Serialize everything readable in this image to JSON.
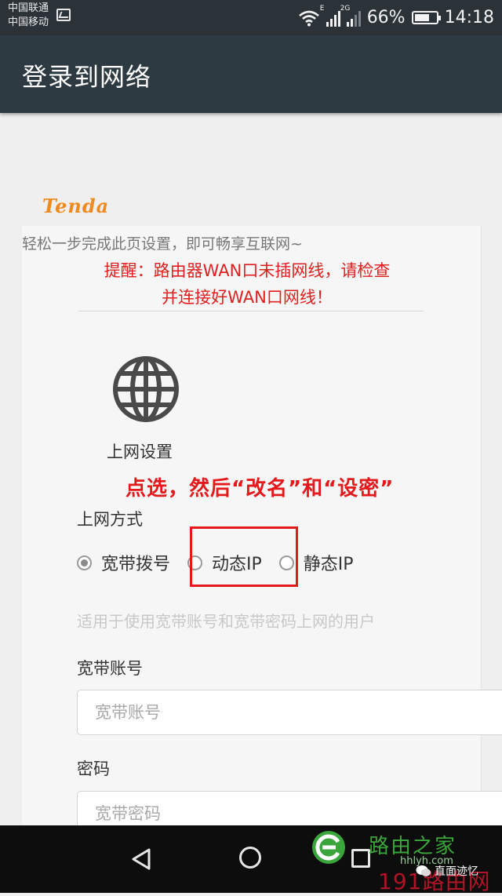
{
  "status_bar": {
    "carrier_1": "中国联通",
    "carrier_2": "中国移动",
    "network_tag_1": "E",
    "network_tag_2": "2G",
    "battery_percent": "66%",
    "time": "14:18",
    "icons": [
      "gallery-icon",
      "wifi-icon",
      "signal-icon",
      "signal-icon",
      "battery-icon"
    ]
  },
  "app_bar": {
    "title": "登录到网络"
  },
  "brand": {
    "logo_text": "Tenda",
    "logo_color": "#ef8a1e"
  },
  "page": {
    "intro": "轻松一步完成此页设置，即可畅享互联网~",
    "reminder_line_1": "提醒：路由器WAN口未插网线，请检查",
    "reminder_line_2": "并连接好WAN口网线！",
    "section_title": "上网设置",
    "section_icon": "globe-icon"
  },
  "annotation": {
    "text": "点选，然后“改名”和“设密”",
    "color": "#e3191b"
  },
  "connection": {
    "label": "上网方式",
    "options": [
      {
        "label": "宽带拨号",
        "checked": true
      },
      {
        "label": "动态IP",
        "checked": false
      },
      {
        "label": "静态IP",
        "checked": false
      }
    ],
    "hint": "适用于使用宽带账号和宽带密码上网的用户"
  },
  "account": {
    "label": "宽带账号",
    "placeholder": "宽带账号"
  },
  "password": {
    "label": "密码",
    "placeholder": "宽带密码"
  },
  "nav_bar": {
    "icons": [
      "back-icon",
      "home-icon",
      "recent-apps-icon"
    ]
  },
  "watermark": {
    "site_name": "路由之家",
    "site_url": "hhlyh.com",
    "site_number": "191路由网",
    "wechat_label": "直面迹忆"
  }
}
